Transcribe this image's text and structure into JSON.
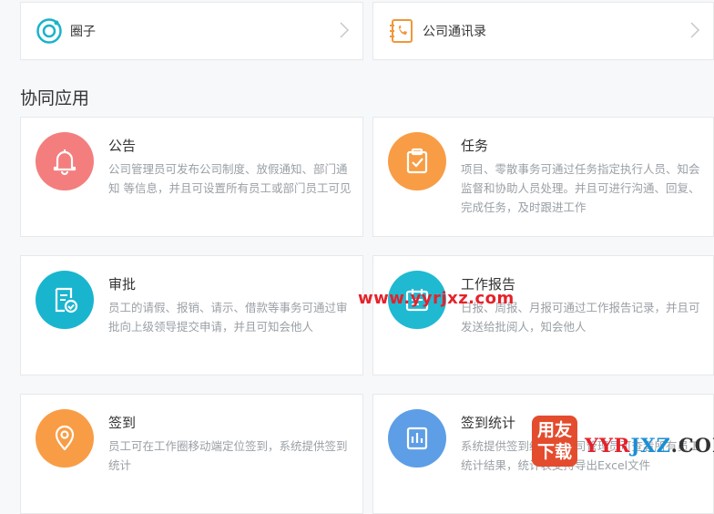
{
  "top_links": [
    {
      "label": "圈子",
      "icon": "circle-ring-icon",
      "color": "#1ab3c9"
    },
    {
      "label": "公司通讯录",
      "icon": "phone-book-icon",
      "color": "#f0973a"
    }
  ],
  "section_title": "协同应用",
  "apps": [
    {
      "title": "公告",
      "desc": "公司管理员可发布公司制度、放假通知、部门通知 等信息，并且可设置所有员工或部门员工可见",
      "icon": "bell-icon",
      "color": "#f47e7e"
    },
    {
      "title": "任务",
      "desc": "项目、零散事务可通过任务指定执行人员、知会监督和协助人员处理。并且可进行沟通、回复、完成任务，及时跟进工作",
      "icon": "task-clipboard-icon",
      "color": "#f89d45"
    },
    {
      "title": "审批",
      "desc": "员工的请假、报销、请示、借款等事务可通过审批向上级领导提交申请，并且可知会他人",
      "icon": "approval-document-icon",
      "color": "#19b5cf"
    },
    {
      "title": "工作报告",
      "desc": "日报、周报、月报可通过工作报告记录，并且可发送给批阅人，知会他人",
      "icon": "calendar-report-icon",
      "color": "#1fb9d2"
    },
    {
      "title": "签到",
      "desc": "员工可在工作圈移动端定位签到，系统提供签到统计",
      "icon": "location-pin-icon",
      "color": "#f89d45"
    },
    {
      "title": "签到统计",
      "desc": "系统提供签到统计，公司管理员可查看所有员工统计结果，统计表支持导出Excel文件",
      "icon": "bar-chart-icon",
      "color": "#5d9ee6"
    }
  ],
  "watermarks": {
    "center_text": "www.yyrjxz.com",
    "badge_top": "用友",
    "badge_bottom": "下载",
    "brand": "YYRJXZ.COM"
  }
}
